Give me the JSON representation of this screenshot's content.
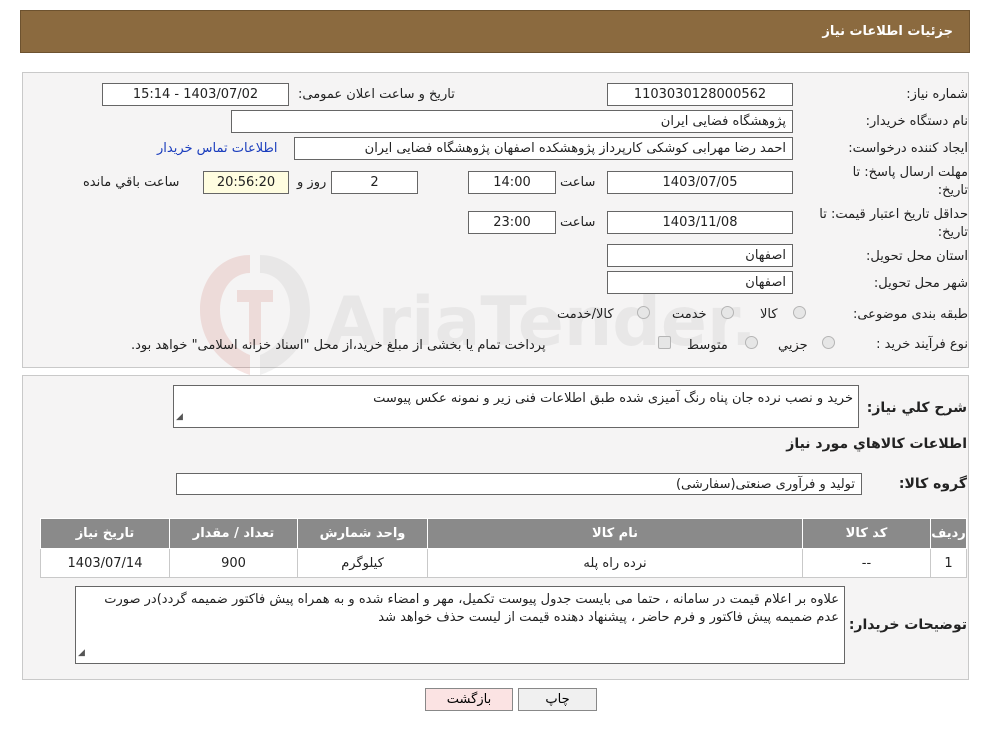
{
  "header": {
    "title": "جزئیات اطلاعات نیاز"
  },
  "fields": {
    "need_number_label": "شماره نیاز:",
    "need_number": "1103030128000562",
    "announce_label": "تاریخ و ساعت اعلان عمومی:",
    "announce_value": "1403/07/02 - 15:14",
    "buyer_org_label": "نام دستگاه خریدار:",
    "buyer_org": "پژوهشگاه فضایی ایران",
    "requester_label": "ایجاد کننده درخواست:",
    "requester": "احمد رضا مهرابی کوشکی کارپرداز پژوهشکده اصفهان پژوهشگاه فضایی ایران",
    "contact_link": "اطلاعات تماس خریدار",
    "deadline_label_1": "مهلت ارسال پاسخ: تا",
    "deadline_label_2": "تاریخ:",
    "deadline_date": "1403/07/05",
    "time_label": "ساعت",
    "deadline_time": "14:00",
    "days_value": "2",
    "days_label": "روز و",
    "remaining_value": "20:56:20",
    "remaining_label": "ساعت باقي مانده",
    "validity_label_1": "حداقل تاریخ اعتبار قیمت: تا",
    "validity_label_2": "تاریخ:",
    "validity_date": "1403/11/08",
    "validity_time": "23:00",
    "province_label": "استان محل تحویل:",
    "province": "اصفهان",
    "city_label": "شهر محل تحویل:",
    "city": "اصفهان",
    "category_label": "طبقه بندی موضوعی:",
    "category_options": [
      "کالا",
      "خدمت",
      "کالا/خدمت"
    ],
    "process_label": "نوع فرآیند خرید :",
    "process_options": [
      "جزیي",
      "متوسط"
    ],
    "process_note": "پرداخت تمام یا بخشی از مبلغ خرید،از محل \"اسناد خزانه اسلامی\" خواهد بود."
  },
  "summary": {
    "label": "شرح كلي نياز:",
    "text": "خرید و نصب نرده جان پناه رنگ آمیزی شده طبق اطلاعات فنی زیر و نمونه عکس پیوست"
  },
  "goods": {
    "section_title": "اطلاعات كالاهاي مورد نياز",
    "group_label": "گروه کالا:",
    "group_value": "تولید و فرآوری صنعتی(سفارشی)",
    "columns": [
      "رديف",
      "کد کالا",
      "نام کالا",
      "واحد شمارش",
      "تعداد / مقدار",
      "تاریخ نیاز"
    ],
    "rows": [
      [
        "1",
        "--",
        "نرده راه پله",
        "کیلوگرم",
        "900",
        "1403/07/14"
      ]
    ]
  },
  "buyer_notes": {
    "label": "توضیحات خریدار:",
    "text": "علاوه بر اعلام قیمت در سامانه ، حتما می بایست جدول پیوست تکمیل، مهر و امضاء شده و به همراه پیش فاکتور ضمیمه گردد)در صورت عدم ضمیمه پیش فاکتور و فرم حاضر ، پیشنهاد دهنده قیمت از لیست حذف خواهد شد"
  },
  "buttons": {
    "print": "چاپ",
    "back": "بازگشت"
  },
  "colors": {
    "header_bg": "#8b6a3f",
    "table_header_bg": "#8a8a8a",
    "link": "#1a3dbd",
    "back_bg": "#fbe3e3"
  }
}
